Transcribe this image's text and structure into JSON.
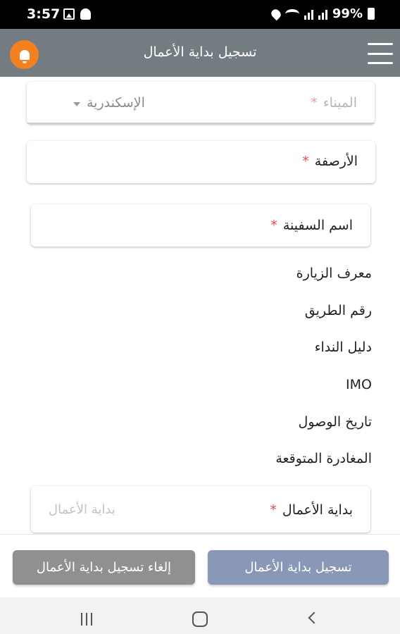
{
  "status_bar": {
    "time": "3:57",
    "battery": "99%",
    "icons": [
      "gallery-icon",
      "ghost-icon",
      "location-icon",
      "wifi-icon",
      "signal-icon",
      "battery-icon"
    ]
  },
  "app_bar": {
    "title": "تسجيل بداية الأعمال",
    "bell_color": "#f4811f",
    "background": "#737c80"
  },
  "form": {
    "port": {
      "label": "الميناء",
      "required_mark": "*",
      "value": "الإسكندرية"
    },
    "berths": {
      "label": "الأرصفة",
      "required_mark": "*"
    },
    "ship_name": {
      "label": "اسم السفينة",
      "required_mark": "*"
    },
    "info_lines": [
      "معرف الزيارة",
      "رقم الطريق",
      "دليل النداء",
      "IMO",
      "تاريخ الوصول",
      "المغادرة المتوقعة"
    ],
    "work_start": {
      "label": "بداية الأعمال",
      "required_mark": "*",
      "placeholder": "بداية الأعمال"
    }
  },
  "buttons": {
    "cancel_label": "إلغاء تسجيل بداية الأعمال",
    "submit_label": "تسجيل بداية الأعمال",
    "cancel_color": "#909090",
    "submit_color": "#8a98b8"
  },
  "nav_bar": {
    "icons": [
      "recents-icon",
      "home-icon",
      "back-icon"
    ]
  }
}
